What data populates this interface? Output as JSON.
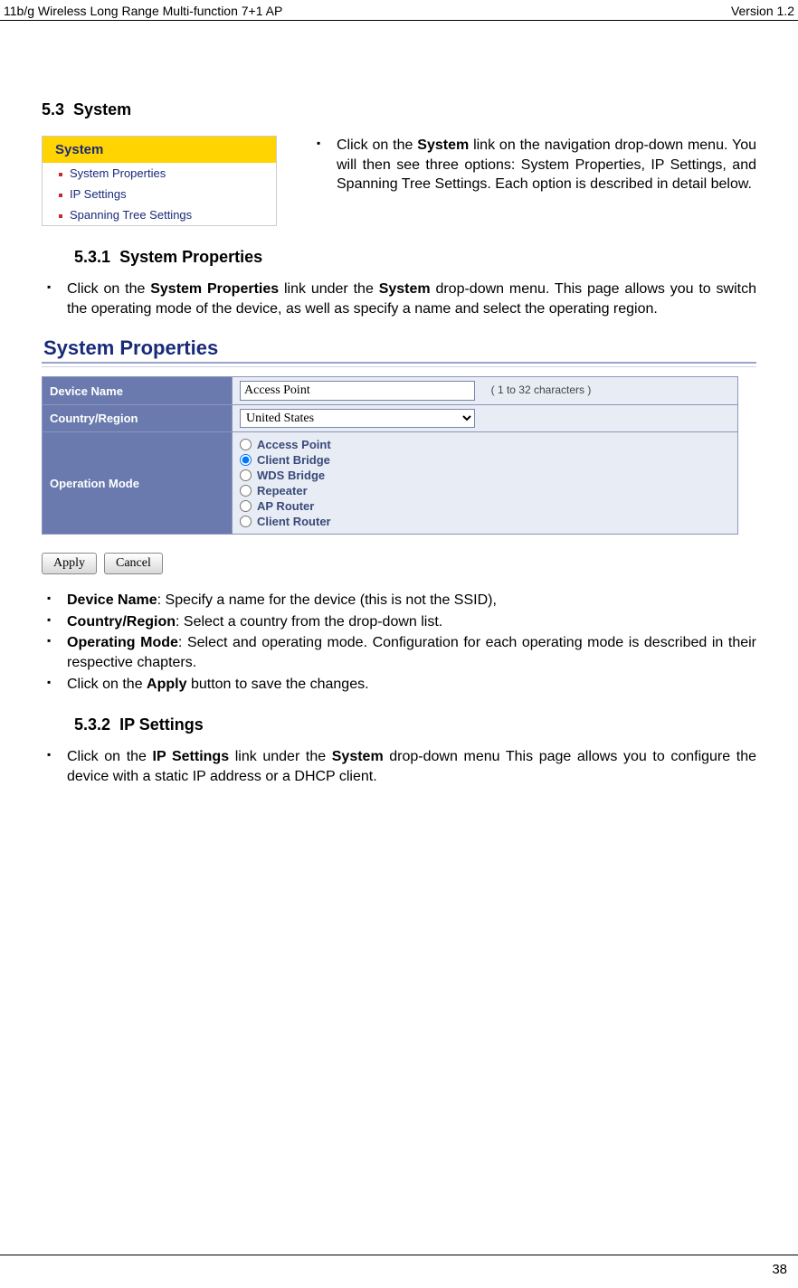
{
  "header": {
    "left": "11b/g Wireless Long Range Multi-function 7+1 AP",
    "right": "Version 1.2"
  },
  "section": {
    "num": "5.3",
    "title": "System"
  },
  "sysMenu": {
    "title": "System",
    "items": [
      "System Properties",
      "IP Settings",
      "Spanning Tree Settings"
    ]
  },
  "intro": "Click on the System link on the navigation drop-down menu. You will then see three options: System Properties, IP Settings, and Spanning Tree Settings. Each option is described in detail below.",
  "sub1": {
    "num": "5.3.1",
    "title": "System Properties"
  },
  "sub1Bullet": "Click on the System Properties link under the System drop-down menu. This page allows you to switch the operating mode of the device, as well as specify a name and select the operating region.",
  "propsPanel": {
    "title": "System Properties",
    "deviceNameLabel": "Device Name",
    "deviceNameValue": "Access Point",
    "charNote": "( 1 to 32 characters )",
    "countryLabel": "Country/Region",
    "countryValue": "United States",
    "opModeLabel": "Operation Mode",
    "modes": [
      "Access Point",
      "Client Bridge",
      "WDS Bridge",
      "Repeater",
      "AP Router",
      "Client Router"
    ],
    "selectedMode": "Client Bridge",
    "applyLabel": "Apply",
    "cancelLabel": "Cancel"
  },
  "afterBullets": {
    "b1a": "Device Name",
    "b1b": ": Specify a name for the device (this is not the SSID),",
    "b2a": "Country/Region",
    "b2b": ": Select a country from the drop-down list.",
    "b3a": "Operating Mode",
    "b3b": ": Select and operating mode. Configuration for each operating mode is described in their respective chapters.",
    "b4a": "Click on the ",
    "b4b": "Apply",
    "b4c": " button to save the changes."
  },
  "sub2": {
    "num": "5.3.2",
    "title": "IP Settings"
  },
  "sub2Bullet1": "Click on the ",
  "sub2Bullet2": "IP Settings",
  "sub2Bullet3": " link under the ",
  "sub2Bullet4": "System",
  "sub2Bullet5": " drop-down menu This page allows you to configure the device with a static IP address or a DHCP client.",
  "pageNum": "38"
}
